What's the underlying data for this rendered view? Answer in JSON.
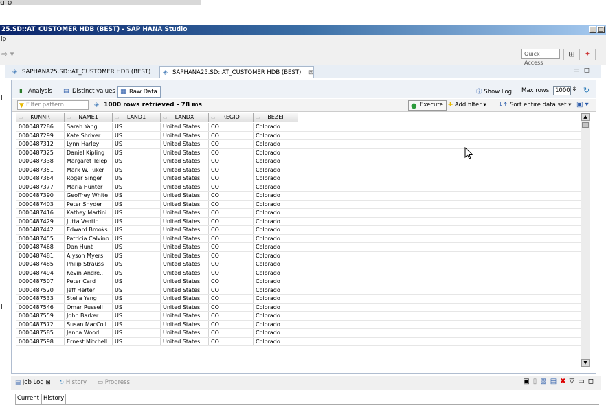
{
  "top_caption": "g  p",
  "window": {
    "title": "25.SD::AT_CUSTOMER HDB (BEST) - SAP HANA Studio"
  },
  "menu": {
    "partial_label": "lp"
  },
  "toolbar": {
    "quick_access_placeholder": "Quick Access"
  },
  "editor_tabs": [
    {
      "label": "SAPHANA25.SD::AT_CUSTOMER HDB (BEST)",
      "active": false
    },
    {
      "label": "SAPHANA25.SD::AT_CUSTOMER HDB (BEST)",
      "active": true
    }
  ],
  "viewer": {
    "tabs": [
      {
        "label": "Analysis",
        "active": false
      },
      {
        "label": "Distinct values",
        "active": false
      },
      {
        "label": "Raw Data",
        "active": true
      }
    ],
    "show_log": "Show Log",
    "max_rows_label": "Max rows:",
    "max_rows_value": "1000",
    "filter_placeholder": "Filter pattern",
    "status": "1000 rows retrieved - 78 ms",
    "execute": "Execute",
    "add_filter": "Add filter",
    "sort_all": "Sort entire data set"
  },
  "grid": {
    "columns": [
      "KUNNR",
      "NAME1",
      "LAND1",
      "LANDX",
      "REGIO",
      "BEZEI"
    ],
    "rows": [
      [
        "0000487286",
        "Sarah Yang",
        "US",
        "United States",
        "CO",
        "Colorado"
      ],
      [
        "0000487299",
        "Kate Shriver",
        "US",
        "United States",
        "CO",
        "Colorado"
      ],
      [
        "0000487312",
        "Lynn Harley",
        "US",
        "United States",
        "CO",
        "Colorado"
      ],
      [
        "0000487325",
        "Daniel Kipling",
        "US",
        "United States",
        "CO",
        "Colorado"
      ],
      [
        "0000487338",
        "Margaret Telep",
        "US",
        "United States",
        "CO",
        "Colorado"
      ],
      [
        "0000487351",
        "Mark W. Riker",
        "US",
        "United States",
        "CO",
        "Colorado"
      ],
      [
        "0000487364",
        "Roger Singer",
        "US",
        "United States",
        "CO",
        "Colorado"
      ],
      [
        "0000487377",
        "Maria Hunter",
        "US",
        "United States",
        "CO",
        "Colorado"
      ],
      [
        "0000487390",
        "Geoffrey White",
        "US",
        "United States",
        "CO",
        "Colorado"
      ],
      [
        "0000487403",
        "Peter Snyder",
        "US",
        "United States",
        "CO",
        "Colorado"
      ],
      [
        "0000487416",
        "Kathey Martini",
        "US",
        "United States",
        "CO",
        "Colorado"
      ],
      [
        "0000487429",
        "Jutta Ventin",
        "US",
        "United States",
        "CO",
        "Colorado"
      ],
      [
        "0000487442",
        "Edward Brooks",
        "US",
        "United States",
        "CO",
        "Colorado"
      ],
      [
        "0000487455",
        "Patricia Calvino",
        "US",
        "United States",
        "CO",
        "Colorado"
      ],
      [
        "0000487468",
        "Dan Hunt",
        "US",
        "United States",
        "CO",
        "Colorado"
      ],
      [
        "0000487481",
        "Alyson Myers",
        "US",
        "United States",
        "CO",
        "Colorado"
      ],
      [
        "0000487485",
        "Philip Strauss",
        "US",
        "United States",
        "CO",
        "Colorado"
      ],
      [
        "0000487494",
        "Kevin Andre...",
        "US",
        "United States",
        "CO",
        "Colorado"
      ],
      [
        "0000487507",
        "Peter Card",
        "US",
        "United States",
        "CO",
        "Colorado"
      ],
      [
        "0000487520",
        "Jeff Herter",
        "US",
        "United States",
        "CO",
        "Colorado"
      ],
      [
        "0000487533",
        "Stella Yang",
        "US",
        "United States",
        "CO",
        "Colorado"
      ],
      [
        "0000487546",
        "Omar Russell",
        "US",
        "United States",
        "CO",
        "Colorado"
      ],
      [
        "0000487559",
        "John Barker",
        "US",
        "United States",
        "CO",
        "Colorado"
      ],
      [
        "0000487572",
        "Susan MacColl",
        "US",
        "United States",
        "CO",
        "Colorado"
      ],
      [
        "0000487585",
        "Jenna Wood",
        "US",
        "United States",
        "CO",
        "Colorado"
      ],
      [
        "0000487598",
        "Ernest Mitchell",
        "US",
        "United States",
        "CO",
        "Colorado"
      ]
    ]
  },
  "bottom": {
    "tabs": [
      {
        "label": "Job Log",
        "active": true
      },
      {
        "label": "History",
        "active": false
      },
      {
        "label": "Progress",
        "active": false
      }
    ],
    "subtabs": [
      "Current",
      "History"
    ]
  }
}
